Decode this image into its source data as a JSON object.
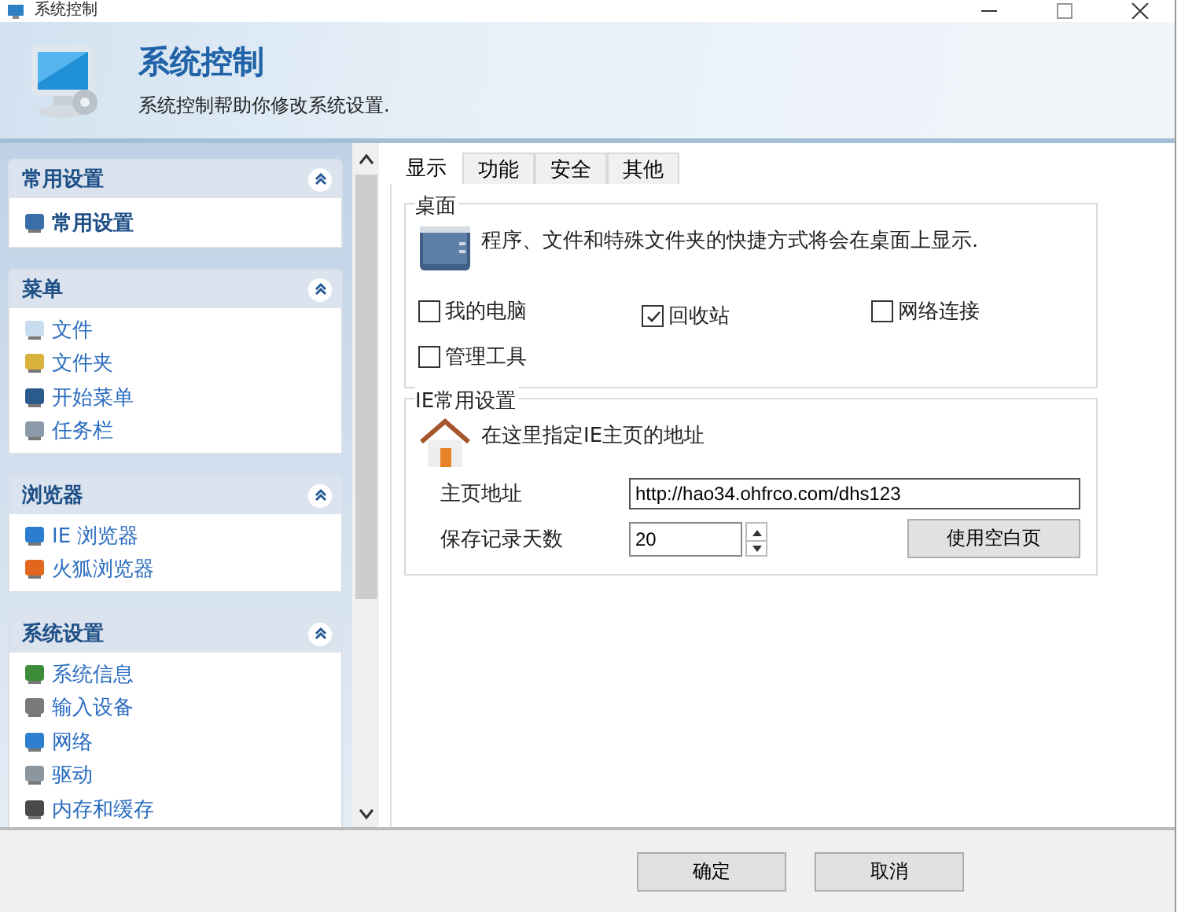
{
  "window": {
    "title": "系统控制"
  },
  "header": {
    "title": "系统控制",
    "subtitle": "系统控制帮助你修改系统设置."
  },
  "sidebar": {
    "groups": [
      {
        "title": "常用设置",
        "expanded": true,
        "items": [
          {
            "label": "常用设置",
            "selected": true
          }
        ]
      },
      {
        "title": "菜单",
        "expanded": true,
        "items": [
          {
            "label": "文件",
            "selected": false
          },
          {
            "label": "文件夹",
            "selected": false
          },
          {
            "label": "开始菜单",
            "selected": false
          },
          {
            "label": "任务栏",
            "selected": false
          }
        ]
      },
      {
        "title": "浏览器",
        "expanded": true,
        "items": [
          {
            "label": "IE 浏览器",
            "selected": false
          },
          {
            "label": "火狐浏览器",
            "selected": false
          }
        ]
      },
      {
        "title": "系统设置",
        "expanded": true,
        "items": [
          {
            "label": "系统信息",
            "selected": false
          },
          {
            "label": "输入设备",
            "selected": false
          },
          {
            "label": "网络",
            "selected": false
          },
          {
            "label": "驱动",
            "selected": false
          },
          {
            "label": "内存和缓存",
            "selected": false
          }
        ]
      }
    ]
  },
  "tabs": [
    {
      "label": "显示",
      "selected": true
    },
    {
      "label": "功能",
      "selected": false
    },
    {
      "label": "安全",
      "selected": false
    },
    {
      "label": "其他",
      "selected": false
    }
  ],
  "desktop": {
    "title": "桌面",
    "description": "程序、文件和特殊文件夹的快捷方式将会在桌面上显示.",
    "checkboxes": [
      {
        "label": "我的电脑",
        "checked": false
      },
      {
        "label": "回收站",
        "checked": true
      },
      {
        "label": "网络连接",
        "checked": false
      },
      {
        "label": "管理工具",
        "checked": false
      }
    ]
  },
  "ie": {
    "title": "IE常用设置",
    "description": "在这里指定IE主页的地址",
    "homepage": {
      "label": "主页地址",
      "value": "http://hao34.ohfrco.com/dhs123"
    },
    "history_days": {
      "label": "保存记录天数",
      "value": "20"
    },
    "blank_button": "使用空白页"
  },
  "buttons": [
    "确定",
    "取消"
  ]
}
